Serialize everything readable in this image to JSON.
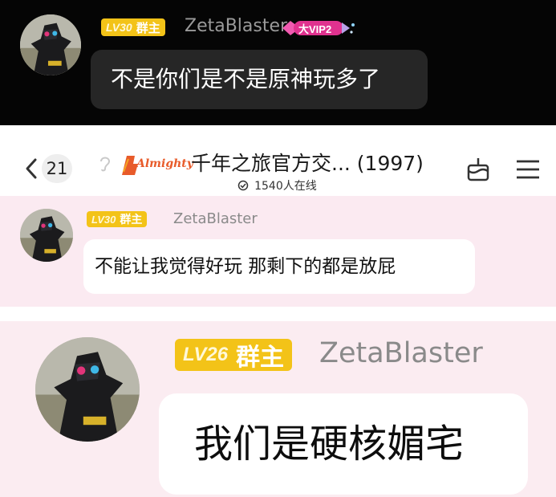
{
  "panel1": {
    "level": "LV30",
    "role": "群主",
    "username": "ZetaBlaster",
    "vip_label": "大VIP2",
    "message": "不是你们是不是原神玩多了"
  },
  "header": {
    "back_count": "21",
    "brand_logo_text": "Almighty",
    "group_title": "千年之旅官方交... (1997)",
    "online_count": "1540人在线"
  },
  "panel2": {
    "level": "LV30",
    "role": "群主",
    "username": "ZetaBlaster",
    "message": "不能让我觉得好玩 那剩下的都是放屁"
  },
  "panel3": {
    "level": "LV26",
    "role": "群主",
    "username": "ZetaBlaster",
    "message": "我们是硬核媚宅"
  },
  "icons": [
    "back-chevron-icon",
    "ear-icon",
    "brand-logo",
    "online-icon",
    "cake-icon",
    "menu-icon",
    "vip-badge"
  ],
  "colors": {
    "level_badge": "#f3c318",
    "vip_badge": "#e0328f",
    "dark_bubble": "#262626",
    "pink_background": "#fbeaf1"
  }
}
